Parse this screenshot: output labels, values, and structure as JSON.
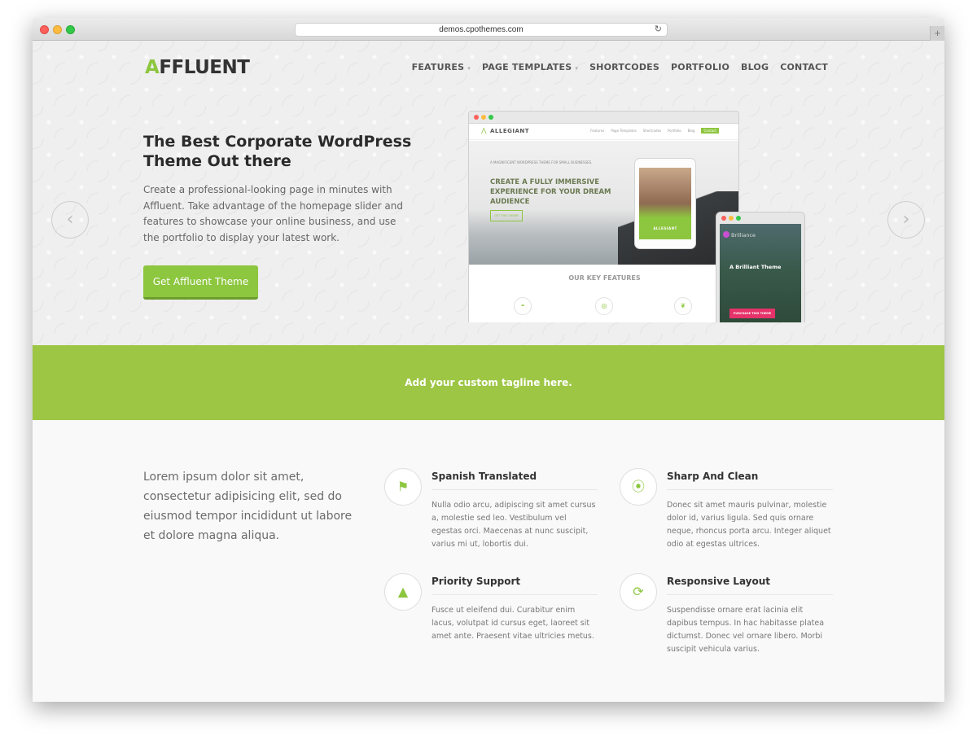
{
  "browser": {
    "url": "demos.cpothemes.com",
    "reload_icon": "reload-icon",
    "new_tab_label": "+"
  },
  "site": {
    "logo_accent": "A",
    "logo_rest": "FFLUENT",
    "nav": [
      {
        "label": "FEATURES",
        "has_dropdown": true
      },
      {
        "label": "PAGE TEMPLATES",
        "has_dropdown": true
      },
      {
        "label": "SHORTCODES",
        "has_dropdown": false
      },
      {
        "label": "PORTFOLIO",
        "has_dropdown": false
      },
      {
        "label": "BLOG",
        "has_dropdown": false
      },
      {
        "label": "CONTACT",
        "has_dropdown": false
      }
    ],
    "dropdown_caret": "▾"
  },
  "hero": {
    "title": "The Best Corporate WordPress Theme Out there",
    "text": "Create a professional-looking page in minutes with Affluent. Take advantage of the homepage slider and features to showcase your online business, and use the portfolio to display your latest work.",
    "button": "Get Affluent Theme",
    "prev_arrow": "‹",
    "next_arrow": "›"
  },
  "mockup": {
    "desktop_logo": "ALLEGIANT",
    "desktop_links": [
      "Features",
      "Page Templates",
      "Shortcodes",
      "Portfolio",
      "Blog",
      "Contact"
    ],
    "desktop_small": "A MAGNIFICENT WORDPRESS THEME FOR SMALL BUSINESSES.",
    "desktop_headline": "CREATE A FULLY IMMERSIVE EXPERIENCE FOR YOUR DREAM AUDIENCE",
    "desktop_button": "GET THIS THEME",
    "desktop_features": "OUR KEY FEATURES",
    "tablet_label": "ALLEGIANT",
    "phone_logo": "Brilliance",
    "phone_title": "A Brilliant Theme",
    "phone_button": "PURCHASE THIS THEME"
  },
  "tagline": "Add your custom tagline here.",
  "content": {
    "intro": "Lorem ipsum dolor sit amet, consectetur adipisicing elit, sed do eiusmod tempor incididunt ut labore et dolore magna aliqua.",
    "features": [
      {
        "title": "Spanish Translated",
        "icon": "flag-icon",
        "glyph": "⚑",
        "desc": "Nulla odio arcu, adipiscing sit amet cursus a, molestie sed leo. Vestibulum vel egestas orci. Maecenas at nunc suscipit, varius mi ut, lobortis dui."
      },
      {
        "title": "Sharp And Clean",
        "icon": "map-pin-icon",
        "glyph": "⦿",
        "desc": "Donec sit amet mauris pulvinar, molestie dolor id, varius ligula. Sed quis ornare neque, rhoncus porta arcu. Integer aliquet odio at egestas ultrices."
      },
      {
        "title": "Priority Support",
        "icon": "road-icon",
        "glyph": "▲",
        "desc": "Fusce ut eleifend dui. Curabitur enim lacus, volutpat id cursus eget, laoreet sit amet ante. Praesent vitae ultricies metus."
      },
      {
        "title": "Responsive Layout",
        "icon": "refresh-icon",
        "glyph": "⟳",
        "desc": "Suspendisse ornare erat lacinia elit dapibus tempus. In hac habitasse platea dictumst. Donec vel ornare libero. Morbi suscipit vehicula varius."
      }
    ]
  },
  "colors": {
    "accent": "#8dc63f",
    "tagline_band": "#9dc645",
    "phone_button": "#e5336a"
  }
}
